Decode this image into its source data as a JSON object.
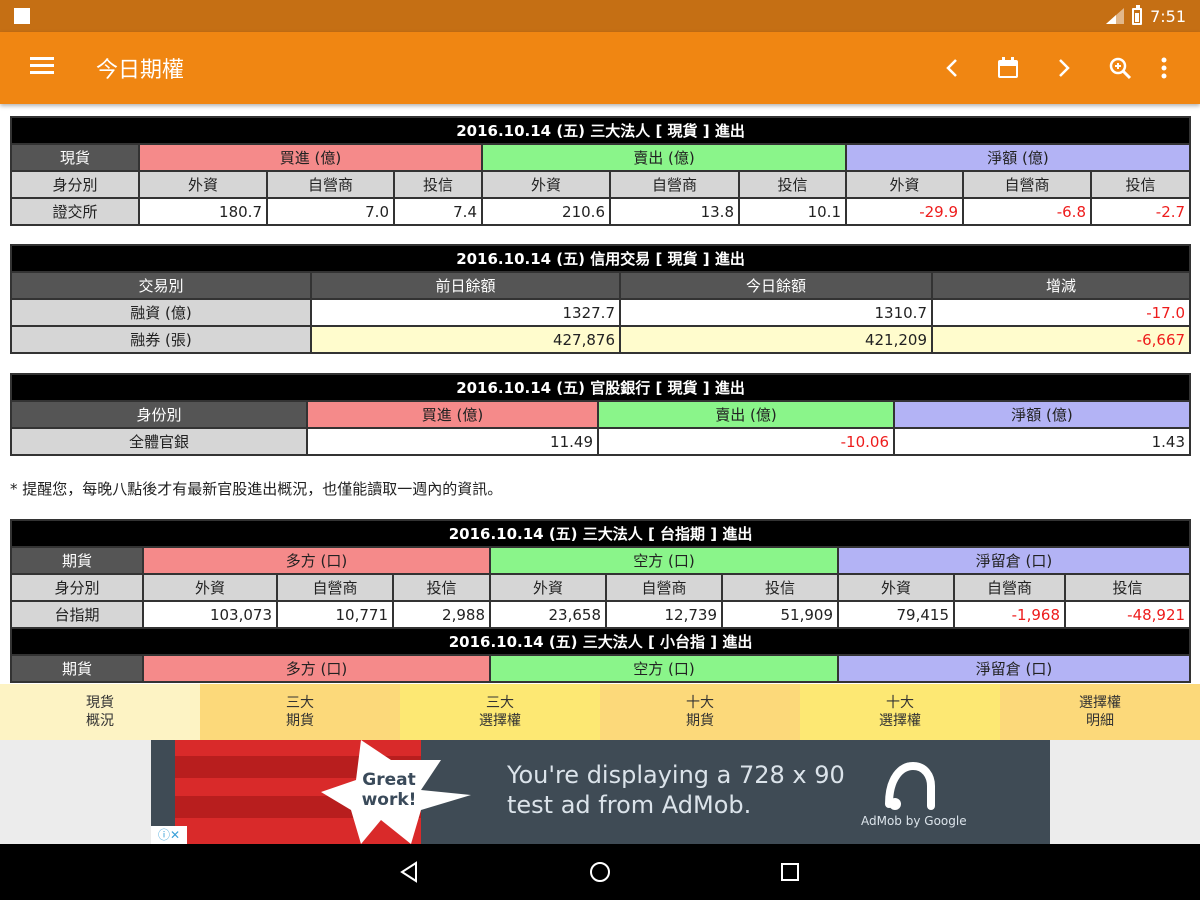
{
  "status": {
    "time": "7:51"
  },
  "appbar": {
    "title": "今日期權"
  },
  "spot": {
    "title": "2016.10.14 (五) 三大法人 [ 現貨 ] 進出",
    "corner": "現貨",
    "groups": [
      "買進 (億)",
      "賣出 (億)",
      "淨額 (億)"
    ],
    "id_header": "身分別",
    "sub": [
      "外資",
      "自營商",
      "投信",
      "外資",
      "自營商",
      "投信",
      "外資",
      "自營商",
      "投信"
    ],
    "row_label": "證交所",
    "values": [
      "180.7",
      "7.0",
      "7.4",
      "210.6",
      "13.8",
      "10.1",
      "-29.9",
      "-6.8",
      "-2.7"
    ]
  },
  "margin": {
    "title": "2016.10.14 (五) 信用交易 [ 現貨 ] 進出",
    "headers": [
      "交易別",
      "前日餘額",
      "今日餘額",
      "增減"
    ],
    "rows": [
      {
        "label": "融資 (億)",
        "values": [
          "1327.7",
          "1310.7",
          "-17.0"
        ]
      },
      {
        "label": "融券 (張)",
        "values": [
          "427,876",
          "421,209",
          "-6,667"
        ]
      }
    ]
  },
  "govbank": {
    "title": "2016.10.14 (五) 官股銀行 [ 現貨 ] 進出",
    "headers": [
      "身份別",
      "買進 (億)",
      "賣出 (億)",
      "淨額 (億)"
    ],
    "row_label": "全體官銀",
    "values": [
      "11.49",
      "-10.06",
      "1.43"
    ]
  },
  "note": "* 提醒您，每晚八點後才有最新官股進出概況，也僅能讀取一週內的資訊。",
  "txf": {
    "title": "2016.10.14 (五) 三大法人 [ 台指期 ] 進出",
    "corner": "期貨",
    "groups": [
      "多方 (口)",
      "空方 (口)",
      "淨留倉 (口)"
    ],
    "id_header": "身分別",
    "sub": [
      "外資",
      "自營商",
      "投信",
      "外資",
      "自營商",
      "投信",
      "外資",
      "自營商",
      "投信"
    ],
    "row_label": "台指期",
    "values": [
      "103,073",
      "10,771",
      "2,988",
      "23,658",
      "12,739",
      "51,909",
      "79,415",
      "-1,968",
      "-48,921"
    ]
  },
  "mtx": {
    "title": "2016.10.14 (五) 三大法人 [ 小台指 ] 進出",
    "corner": "期貨",
    "groups": [
      "多方 (口)",
      "空方 (口)",
      "淨留倉 (口)"
    ]
  },
  "tabs": [
    {
      "label": "現貨\n概況",
      "color": "#fdf3c4"
    },
    {
      "label": "三大\n期貨",
      "color": "#fcd97a"
    },
    {
      "label": "三大\n選擇權",
      "color": "#fde873"
    },
    {
      "label": "十大\n期貨",
      "color": "#fcd97a"
    },
    {
      "label": "十大\n選擇權",
      "color": "#fde873"
    },
    {
      "label": "選擇權\n明細",
      "color": "#fcd97a"
    }
  ],
  "ad": {
    "badge": "Great\nwork!",
    "text_line1": "You're displaying a 728 x 90",
    "text_line2": "test ad from AdMob.",
    "brand": "AdMob by Google"
  },
  "colors": {
    "statusbar": "#c56f14",
    "appbar": "#f08612",
    "negative": "#ee1c1c"
  }
}
